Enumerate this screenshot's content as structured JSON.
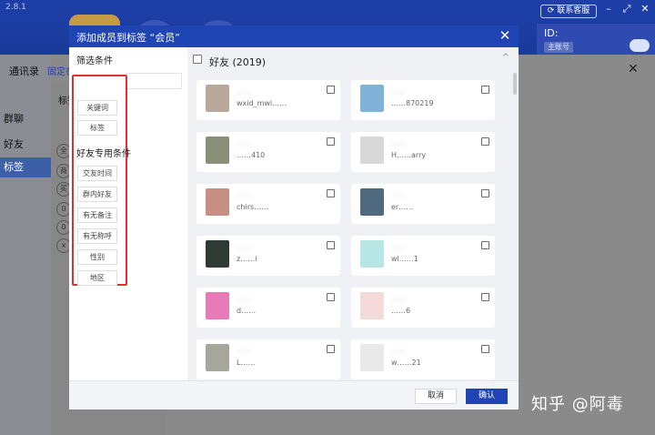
{
  "app": {
    "version": "2.8.1",
    "service_label": "联系客服",
    "id_label": "ID:",
    "main_account": "主账号",
    "minimize": "–",
    "maximize": "⤢",
    "close": "✕",
    "accent": "#1f44b4"
  },
  "sidebar": {
    "items": [
      {
        "label": "群聊"
      },
      {
        "label": "好友"
      },
      {
        "label": "标签"
      }
    ]
  },
  "background": {
    "address_book": "通讯录",
    "fixed_label": "固定在",
    "tag_label": "标签",
    "chips": [
      "全",
      "商",
      "买",
      "0",
      "0",
      "x"
    ],
    "close": "✕"
  },
  "dialog": {
    "title": "添加成员到标签 “会员”",
    "close": "✕",
    "filter": {
      "title": "筛选条件",
      "keyword_btn": "关键词",
      "tag_btn": "标签",
      "friend_title": "好友专用条件",
      "buttons": [
        "交友时间",
        "群内好友",
        "有无备注",
        "有无称呼",
        "性别",
        "地区"
      ]
    },
    "group": {
      "label": "好友 (2019)",
      "arrow": "^"
    },
    "contacts": [
      {
        "name": "……",
        "sub": "wxid_mwi……",
        "color": "#b9a89a"
      },
      {
        "name": "……",
        "sub": "……870219",
        "color": "#7fb3d8"
      },
      {
        "name": "……",
        "sub": "……410",
        "color": "#8a8f77"
      },
      {
        "name": "……",
        "sub": "H……arry",
        "color": "#d8d8d8"
      },
      {
        "name": "……",
        "sub": "chirs……",
        "color": "#c78f84"
      },
      {
        "name": "……",
        "sub": "er……",
        "color": "#4f6a7e"
      },
      {
        "name": "……",
        "sub": "z……i",
        "color": "#2f3a35"
      },
      {
        "name": "……",
        "sub": "wl……1",
        "color": "#b8e6e4"
      },
      {
        "name": "……",
        "sub": "d……",
        "color": "#e87ab8"
      },
      {
        "name": "……",
        "sub": "……6",
        "color": "#f4dada"
      },
      {
        "name": "……",
        "sub": "L……",
        "color": "#a7a69a"
      },
      {
        "name": "……",
        "sub": "w……21",
        "color": "#e9e9e9"
      }
    ],
    "cancel": "取消",
    "confirm": "确认"
  },
  "watermark": "知乎 @阿毒"
}
